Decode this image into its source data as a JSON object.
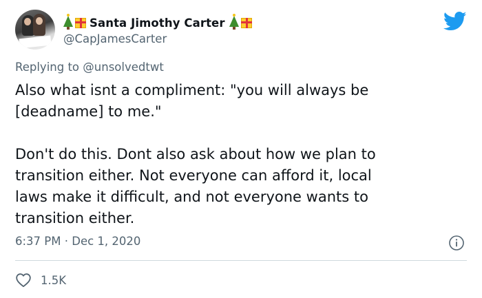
{
  "author": {
    "display_name": "Santa Jimothy Carter",
    "handle": "@CapJamesCarter",
    "name_emojis": [
      "christmas-tree",
      "wrapped-gift"
    ]
  },
  "reply": {
    "prefix": "Replying to",
    "target": "@unsolvedtwt"
  },
  "tweet": {
    "paragraph_1_line_1": "Also what isnt a compliment: \"you will always be",
    "paragraph_1_line_2": "[deadname] to me.\"",
    "paragraph_2_line_1": "Don't do this. Dont also ask about how we plan to",
    "paragraph_2_line_2": "transition either. Not everyone can afford it, local",
    "paragraph_2_line_3": "laws make it difficult, and not everyone wants to",
    "paragraph_2_line_4": "transition either."
  },
  "timestamp": {
    "time": "6:37 PM",
    "separator": "·",
    "date": "Dec 1, 2020"
  },
  "stats": {
    "likes": "1.5K"
  },
  "colors": {
    "text": "#0f1419",
    "secondary": "#536471",
    "brand": "#1d9bf0",
    "divider": "#cfd9de"
  }
}
